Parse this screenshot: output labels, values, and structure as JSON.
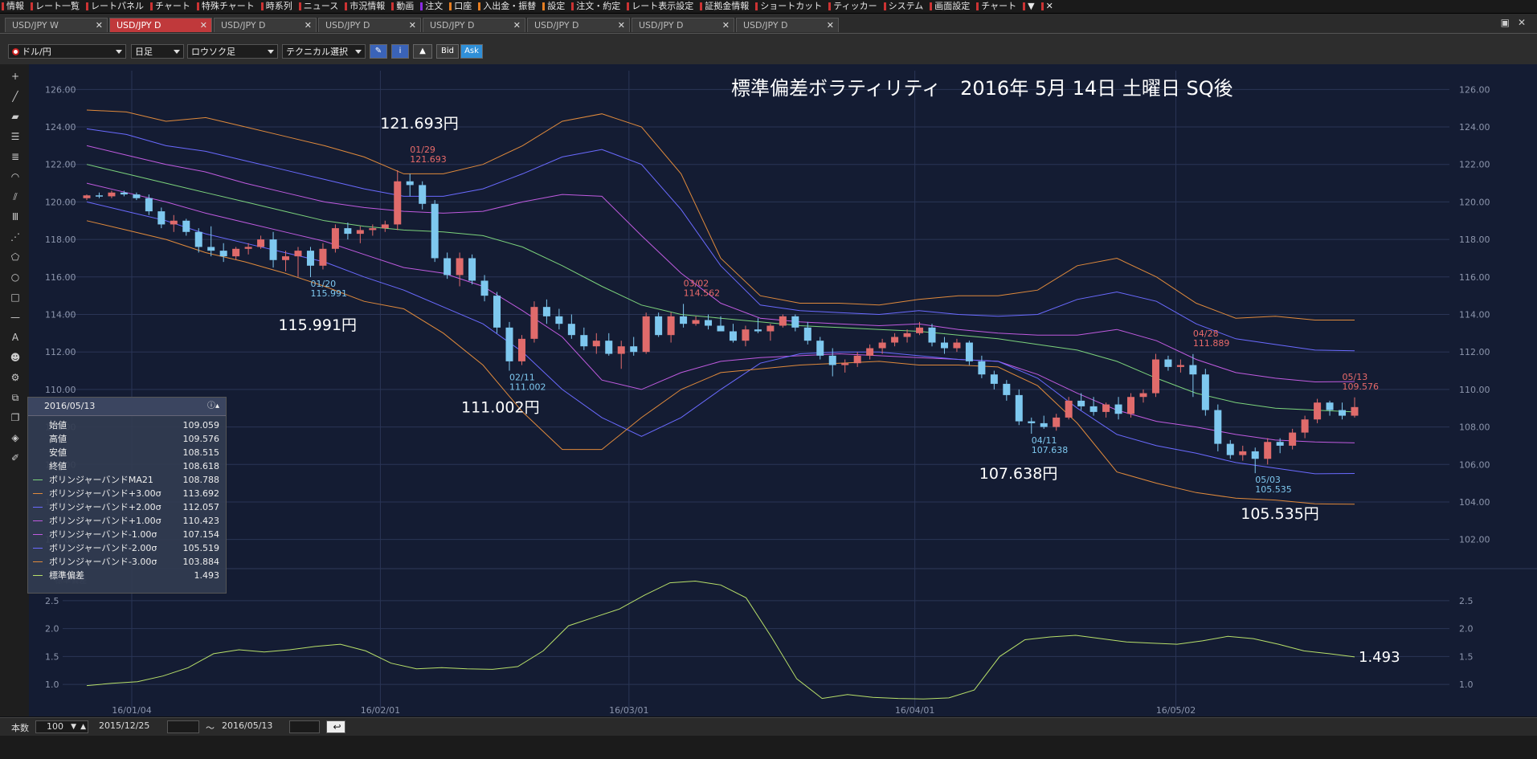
{
  "menu": [
    "情報",
    "レート一覧",
    "レートパネル",
    "チャート",
    "特殊チャート",
    "時系列",
    "ニュース",
    "市況情報",
    "動画",
    "注文",
    "口座",
    "入出金・振替",
    "設定",
    "注文・約定",
    "レート表示設定",
    "証拠金情報",
    "ショートカット",
    "ティッカー",
    "システム",
    "画面設定",
    "チャート",
    "▼",
    "✕"
  ],
  "tabs": [
    {
      "label": "USD/JPY W",
      "active": false
    },
    {
      "label": "USD/JPY D",
      "active": true
    },
    {
      "label": "USD/JPY D",
      "active": false
    },
    {
      "label": "USD/JPY D",
      "active": false
    },
    {
      "label": "USD/JPY D",
      "active": false
    },
    {
      "label": "USD/JPY D",
      "active": false
    },
    {
      "label": "USD/JPY D",
      "active": false
    },
    {
      "label": "USD/JPY D",
      "active": false
    }
  ],
  "toolbar": {
    "pair": "ドル/円",
    "period": "日足",
    "chart_type": "ロウソク足",
    "technical": "テクニカル選択",
    "bid": "Bid",
    "ask": "Ask"
  },
  "bottom": {
    "count_label": "本数",
    "count_value": "100",
    "date_from": "2015/12/25",
    "tilde": "〜",
    "date_to": "2016/05/13"
  },
  "info_panel": {
    "date": "2016/05/13",
    "rows": [
      {
        "label": "始値",
        "value": "109.059",
        "color": ""
      },
      {
        "label": "高値",
        "value": "109.576",
        "color": ""
      },
      {
        "label": "安値",
        "value": "108.515",
        "color": ""
      },
      {
        "label": "終値",
        "value": "108.618",
        "color": ""
      },
      {
        "label": "ボリンジャーバンドMA21",
        "value": "108.788",
        "color": "#7cd37c"
      },
      {
        "label": "ボリンジャーバンド+3.00σ",
        "value": "113.692",
        "color": "#e08a3c"
      },
      {
        "label": "ボリンジャーバンド+2.00σ",
        "value": "112.057",
        "color": "#6a6aff"
      },
      {
        "label": "ボリンジャーバンド+1.00σ",
        "value": "110.423",
        "color": "#c05be0"
      },
      {
        "label": "ボリンジャーバンド-1.00σ",
        "value": "107.154",
        "color": "#c05be0"
      },
      {
        "label": "ボリンジャーバンド-2.00σ",
        "value": "105.519",
        "color": "#6a6aff"
      },
      {
        "label": "ボリンジャーバンド-3.00σ",
        "value": "103.884",
        "color": "#e08a3c"
      },
      {
        "label": "標準偏差",
        "value": "1.493",
        "color": "#b8e06a"
      }
    ]
  },
  "chart_data": {
    "type": "candlestick",
    "title": "標準偏差ボラティリティ　2016年 5月 14日 土曜日 SQ後",
    "price_axis": {
      "ticks": [
        "126.00",
        "124.00",
        "122.00",
        "120.00",
        "118.00",
        "116.00",
        "114.00",
        "112.00",
        "110.00",
        "108.00",
        "106.00",
        "104.00",
        "102.00"
      ],
      "ylim": [
        101.0,
        127.0
      ]
    },
    "sd_axis": {
      "ticks": [
        "2.5",
        "2.0",
        "1.5",
        "1.0"
      ],
      "ylim": [
        0.6,
        2.9
      ]
    },
    "x_labels": [
      "16/01/04",
      "16/02/01",
      "16/03/01",
      "16/04/01",
      "16/05/02"
    ],
    "candles": [
      [
        120.2,
        120.4,
        120.1,
        120.35
      ],
      [
        120.35,
        120.5,
        120.2,
        120.3
      ],
      [
        120.3,
        120.6,
        120.2,
        120.5
      ],
      [
        120.5,
        120.6,
        120.3,
        120.4
      ],
      [
        120.4,
        120.5,
        120.1,
        120.2
      ],
      [
        120.2,
        120.4,
        119.3,
        119.5
      ],
      [
        119.5,
        119.7,
        118.6,
        118.8
      ],
      [
        118.8,
        119.3,
        118.4,
        119.0
      ],
      [
        119.0,
        119.1,
        118.2,
        118.4
      ],
      [
        118.4,
        118.6,
        117.3,
        117.6
      ],
      [
        117.6,
        118.7,
        117.1,
        117.4
      ],
      [
        117.4,
        117.8,
        116.8,
        117.1
      ],
      [
        117.1,
        117.6,
        116.9,
        117.5
      ],
      [
        117.5,
        117.8,
        117.2,
        117.6
      ],
      [
        117.6,
        118.2,
        117.5,
        118.0
      ],
      [
        118.0,
        118.4,
        116.5,
        116.9
      ],
      [
        116.9,
        117.4,
        116.3,
        117.1
      ],
      [
        117.1,
        117.6,
        116.0,
        117.4
      ],
      [
        117.4,
        117.6,
        115.99,
        116.6
      ],
      [
        116.6,
        117.8,
        116.4,
        117.5
      ],
      [
        117.5,
        118.8,
        117.3,
        118.6
      ],
      [
        118.6,
        118.9,
        118.0,
        118.3
      ],
      [
        118.3,
        118.7,
        117.8,
        118.5
      ],
      [
        118.5,
        118.8,
        118.2,
        118.6
      ],
      [
        118.6,
        119.0,
        118.4,
        118.8
      ],
      [
        118.8,
        121.693,
        118.5,
        121.1
      ],
      [
        121.1,
        121.5,
        120.3,
        120.9
      ],
      [
        120.9,
        121.1,
        119.6,
        119.9
      ],
      [
        119.9,
        120.1,
        116.8,
        117.0
      ],
      [
        117.0,
        117.3,
        115.9,
        116.1
      ],
      [
        116.1,
        117.3,
        115.5,
        117.0
      ],
      [
        117.0,
        117.2,
        115.6,
        115.8
      ],
      [
        115.8,
        116.1,
        114.7,
        115.0
      ],
      [
        115.0,
        115.2,
        113.0,
        113.3
      ],
      [
        113.3,
        113.6,
        111.002,
        111.5
      ],
      [
        111.5,
        112.9,
        111.3,
        112.7
      ],
      [
        112.7,
        114.7,
        112.5,
        114.4
      ],
      [
        114.4,
        114.8,
        113.5,
        113.9
      ],
      [
        113.9,
        114.3,
        113.2,
        113.5
      ],
      [
        113.5,
        114.0,
        112.7,
        112.9
      ],
      [
        112.9,
        113.3,
        112.1,
        112.3
      ],
      [
        112.3,
        113.0,
        111.9,
        112.6
      ],
      [
        112.6,
        113.0,
        111.8,
        111.9
      ],
      [
        111.9,
        112.6,
        111.1,
        112.3
      ],
      [
        112.3,
        112.8,
        111.8,
        112.0
      ],
      [
        112.0,
        114.1,
        111.9,
        113.9
      ],
      [
        113.9,
        114.1,
        112.8,
        112.9
      ],
      [
        112.9,
        114.1,
        112.5,
        113.9
      ],
      [
        113.9,
        114.562,
        113.3,
        113.5
      ],
      [
        113.5,
        113.9,
        113.4,
        113.7
      ],
      [
        113.7,
        114.0,
        113.2,
        113.4
      ],
      [
        113.4,
        113.9,
        113.1,
        113.1
      ],
      [
        113.1,
        113.5,
        112.5,
        112.6
      ],
      [
        112.6,
        113.4,
        112.3,
        113.2
      ],
      [
        113.2,
        113.8,
        113.0,
        113.1
      ],
      [
        113.1,
        113.5,
        112.6,
        113.4
      ],
      [
        113.4,
        114.0,
        113.3,
        113.9
      ],
      [
        113.9,
        114.0,
        113.1,
        113.3
      ],
      [
        113.3,
        113.6,
        112.4,
        112.6
      ],
      [
        112.6,
        112.8,
        111.6,
        111.8
      ],
      [
        111.8,
        112.2,
        110.7,
        111.3
      ],
      [
        111.3,
        111.6,
        110.9,
        111.4
      ],
      [
        111.4,
        112.0,
        111.2,
        111.8
      ],
      [
        111.8,
        112.4,
        111.6,
        112.2
      ],
      [
        112.2,
        112.7,
        111.9,
        112.5
      ],
      [
        112.5,
        113.0,
        112.3,
        112.8
      ],
      [
        112.8,
        113.2,
        112.5,
        113.0
      ],
      [
        113.0,
        113.6,
        112.9,
        113.3
      ],
      [
        113.3,
        113.5,
        112.3,
        112.5
      ],
      [
        112.5,
        112.8,
        111.9,
        112.2
      ],
      [
        112.2,
        112.7,
        112.0,
        112.5
      ],
      [
        112.5,
        112.6,
        111.3,
        111.5
      ],
      [
        111.5,
        111.8,
        110.6,
        110.8
      ],
      [
        110.8,
        111.0,
        110.0,
        110.3
      ],
      [
        110.3,
        110.5,
        109.4,
        109.7
      ],
      [
        109.7,
        110.0,
        108.1,
        108.3
      ],
      [
        108.3,
        108.5,
        107.638,
        108.2
      ],
      [
        108.2,
        108.6,
        107.9,
        108.0
      ],
      [
        108.0,
        108.7,
        107.8,
        108.5
      ],
      [
        108.5,
        109.6,
        108.4,
        109.4
      ],
      [
        109.4,
        109.8,
        108.9,
        109.1
      ],
      [
        109.1,
        109.6,
        108.6,
        108.8
      ],
      [
        108.8,
        109.3,
        108.5,
        109.2
      ],
      [
        109.2,
        109.6,
        108.4,
        108.7
      ],
      [
        108.7,
        109.8,
        108.5,
        109.6
      ],
      [
        109.6,
        110.0,
        109.3,
        109.8
      ],
      [
        109.8,
        111.9,
        109.6,
        111.6
      ],
      [
        111.6,
        111.8,
        111.0,
        111.2
      ],
      [
        111.2,
        111.6,
        110.9,
        111.3
      ],
      [
        111.3,
        111.889,
        109.6,
        110.8
      ],
      [
        110.8,
        111.1,
        108.6,
        108.9
      ],
      [
        108.9,
        109.2,
        106.7,
        107.1
      ],
      [
        107.1,
        107.3,
        106.3,
        106.5
      ],
      [
        106.5,
        107.0,
        106.2,
        106.7
      ],
      [
        106.7,
        106.9,
        105.535,
        106.3
      ],
      [
        106.3,
        107.4,
        106.0,
        107.2
      ],
      [
        107.2,
        107.4,
        106.6,
        107.0
      ],
      [
        107.0,
        107.9,
        106.8,
        107.7
      ],
      [
        107.7,
        108.6,
        107.4,
        108.4
      ],
      [
        108.4,
        109.5,
        108.2,
        109.3
      ],
      [
        109.3,
        109.4,
        108.6,
        108.9
      ],
      [
        108.9,
        109.3,
        108.4,
        108.6
      ],
      [
        108.6,
        109.576,
        108.5,
        109.06
      ]
    ],
    "bands": {
      "ma21": [
        122.0,
        121.5,
        121.0,
        120.5,
        120.0,
        119.5,
        119.0,
        118.7,
        118.5,
        118.4,
        118.2,
        117.6,
        116.6,
        115.5,
        114.5,
        114.0,
        113.8,
        113.6,
        113.4,
        113.3,
        113.2,
        113.1,
        112.9,
        112.7,
        112.4,
        112.1,
        111.5,
        110.6,
        109.8,
        109.3,
        109.0,
        108.9,
        108.8
      ],
      "p3": [
        124.9,
        124.8,
        124.3,
        124.5,
        124.0,
        123.5,
        123.0,
        122.4,
        121.5,
        121.5,
        122.0,
        123.0,
        124.3,
        124.7,
        124.0,
        121.5,
        117.0,
        115.0,
        114.6,
        114.6,
        114.5,
        114.8,
        115.0,
        115.0,
        115.3,
        116.6,
        117.0,
        116.0,
        114.6,
        113.8,
        113.9,
        113.7,
        113.7
      ],
      "p2": [
        123.9,
        123.6,
        123.0,
        122.7,
        122.2,
        121.7,
        121.2,
        120.7,
        120.3,
        120.3,
        120.7,
        121.5,
        122.4,
        122.8,
        122.0,
        119.6,
        116.6,
        114.5,
        114.2,
        114.1,
        114.0,
        114.2,
        114.0,
        113.9,
        114.0,
        114.8,
        115.2,
        114.7,
        113.5,
        112.7,
        112.4,
        112.1,
        112.06
      ],
      "p1": [
        123.0,
        122.5,
        122.0,
        121.6,
        121.0,
        120.5,
        120.0,
        119.7,
        119.5,
        119.4,
        119.5,
        120.0,
        120.4,
        120.3,
        118.2,
        116.2,
        114.6,
        113.8,
        113.6,
        113.5,
        113.4,
        113.5,
        113.2,
        113.0,
        112.9,
        112.9,
        113.2,
        112.6,
        111.6,
        110.9,
        110.6,
        110.4,
        110.42
      ],
      "m1": [
        121.0,
        120.5,
        120.0,
        119.4,
        118.9,
        118.4,
        117.9,
        117.2,
        116.5,
        116.2,
        115.5,
        114.2,
        112.8,
        110.5,
        110.0,
        110.9,
        111.5,
        111.7,
        111.8,
        111.9,
        111.8,
        111.7,
        111.6,
        111.5,
        110.8,
        109.8,
        108.9,
        108.3,
        108.0,
        107.6,
        107.3,
        107.2,
        107.15
      ],
      "m2": [
        120.0,
        119.5,
        119.0,
        118.3,
        117.8,
        117.3,
        116.8,
        116.0,
        115.3,
        114.4,
        113.5,
        112.0,
        110.0,
        108.5,
        107.5,
        108.5,
        110.0,
        111.4,
        111.9,
        112.0,
        112.0,
        111.8,
        111.6,
        111.5,
        110.6,
        109.0,
        107.6,
        107.0,
        106.6,
        106.1,
        105.8,
        105.5,
        105.52
      ],
      "m3": [
        119.0,
        118.5,
        118.0,
        117.3,
        116.8,
        116.2,
        115.5,
        114.7,
        114.3,
        113.0,
        111.3,
        108.8,
        106.8,
        106.8,
        108.5,
        110.0,
        110.9,
        111.1,
        111.3,
        111.4,
        111.5,
        111.3,
        111.3,
        111.2,
        110.2,
        108.2,
        105.6,
        105.0,
        104.5,
        104.2,
        104.1,
        103.9,
        103.88
      ]
    },
    "sd_series": [
      0.98,
      1.02,
      1.05,
      1.15,
      1.3,
      1.55,
      1.62,
      1.58,
      1.62,
      1.68,
      1.72,
      1.6,
      1.38,
      1.28,
      1.3,
      1.28,
      1.27,
      1.32,
      1.6,
      2.05,
      2.2,
      2.35,
      2.6,
      2.82,
      2.85,
      2.78,
      2.55,
      1.85,
      1.1,
      0.75,
      0.82,
      0.77,
      0.75,
      0.74,
      0.76,
      0.9,
      1.5,
      1.8,
      1.85,
      1.88,
      1.82,
      1.76,
      1.74,
      1.72,
      1.78,
      1.86,
      1.82,
      1.72,
      1.6,
      1.55,
      1.493
    ],
    "annotations": [
      {
        "text": "121.693円",
        "kind": "big",
        "x": 26,
        "y": 121.693
      },
      {
        "text": "01/29",
        "kind": "hi",
        "x": 26,
        "y": 121.693
      },
      {
        "text": "121.693",
        "kind": "hi2",
        "x": 26,
        "y": 121.693
      },
      {
        "text": "115.991円",
        "kind": "big",
        "x": 18,
        "y": 115.991
      },
      {
        "text": "01/20",
        "kind": "lo",
        "x": 18,
        "y": 115.991
      },
      {
        "text": "115.991",
        "kind": "lo2",
        "x": 18,
        "y": 115.991
      },
      {
        "text": "111.002円",
        "kind": "big",
        "x": 34,
        "y": 111.002
      },
      {
        "text": "02/11",
        "kind": "lo",
        "x": 34,
        "y": 111.002
      },
      {
        "text": "111.002",
        "kind": "lo2",
        "x": 34,
        "y": 111.002
      },
      {
        "text": "03/02",
        "kind": "hi",
        "x": 48,
        "y": 114.562
      },
      {
        "text": "114.562",
        "kind": "hi2",
        "x": 48,
        "y": 114.562
      },
      {
        "text": "107.638円",
        "kind": "big",
        "x": 76,
        "y": 107.638
      },
      {
        "text": "04/11",
        "kind": "lo",
        "x": 76,
        "y": 107.638
      },
      {
        "text": "107.638",
        "kind": "lo2",
        "x": 76,
        "y": 107.638
      },
      {
        "text": "04/28",
        "kind": "hi",
        "x": 89,
        "y": 111.889
      },
      {
        "text": "111.889",
        "kind": "hi2",
        "x": 89,
        "y": 111.889
      },
      {
        "text": "105.535円",
        "kind": "big",
        "x": 94,
        "y": 105.535
      },
      {
        "text": "05/03",
        "kind": "lo",
        "x": 94,
        "y": 105.535
      },
      {
        "text": "105.535",
        "kind": "lo2",
        "x": 94,
        "y": 105.535
      },
      {
        "text": "05/13",
        "kind": "hi",
        "x": 101,
        "y": 109.576
      },
      {
        "text": "109.576",
        "kind": "hi2",
        "x": 101,
        "y": 109.576
      }
    ],
    "sd_label": "1.493",
    "sd_series_label": "標準偏差",
    "colors": {
      "up": "#e06b6b",
      "down": "#7ec8ef",
      "ma21": "#7cd37c",
      "s1": "#c05be0",
      "s2": "#6a6aff",
      "s3": "#e08a3c",
      "sd": "#b8e06a"
    }
  }
}
